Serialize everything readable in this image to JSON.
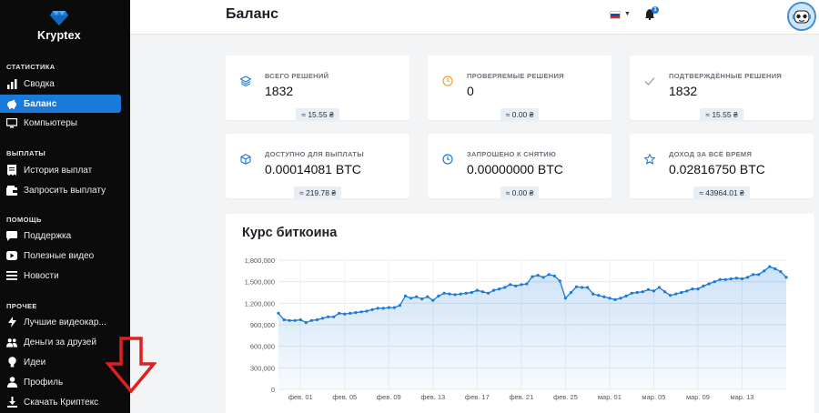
{
  "brand": {
    "name": "Kryptex",
    "accent": "#1a7ad9"
  },
  "sidebar": {
    "sections": [
      {
        "title": "СТАТИСТИКА",
        "items": [
          {
            "label": "Сводка",
            "icon": "chart-bar-icon"
          },
          {
            "label": "Баланс",
            "icon": "piggy-bank-icon",
            "active": true
          },
          {
            "label": "Компьютеры",
            "icon": "monitor-icon"
          }
        ]
      },
      {
        "title": "ВЫПЛАТЫ",
        "items": [
          {
            "label": "История выплат",
            "icon": "receipt-icon"
          },
          {
            "label": "Запросить выплату",
            "icon": "wallet-icon"
          }
        ]
      },
      {
        "title": "ПОМОЩЬ",
        "items": [
          {
            "label": "Поддержка",
            "icon": "chat-icon"
          },
          {
            "label": "Полезные видео",
            "icon": "youtube-icon"
          },
          {
            "label": "Новости",
            "icon": "list-icon"
          }
        ]
      },
      {
        "title": "ПРОЧЕЕ",
        "items": [
          {
            "label": "Лучшие видеокар...",
            "icon": "bolt-icon"
          },
          {
            "label": "Деньги за друзей",
            "icon": "users-icon"
          },
          {
            "label": "Идеи",
            "icon": "lightbulb-icon"
          },
          {
            "label": "Профиль",
            "icon": "user-icon"
          },
          {
            "label": "Скачать Криптекс",
            "icon": "download-icon"
          }
        ]
      }
    ]
  },
  "header": {
    "title": "Баланс",
    "notification_count": "1",
    "language": "ru"
  },
  "stats": [
    {
      "label": "ВСЕГО РЕШЕНИЙ",
      "value": "1832",
      "equiv": "≈ 15.55 ₴",
      "icon": "layers-icon",
      "icon_color": "#1a7ad9"
    },
    {
      "label": "ПРОВЕРЯЕМЫЕ РЕШЕНИЯ",
      "value": "0",
      "equiv": "≈ 0.00 ₴",
      "icon": "clock-icon",
      "icon_color": "#f0a13a"
    },
    {
      "label": "ПОДТВЕРЖДЁННЫЕ РЕШЕНИЯ",
      "value": "1832",
      "equiv": "≈ 15.55 ₴",
      "icon": "check-icon",
      "icon_color": "#9aa0aa"
    },
    {
      "label": "ДОСТУПНО ДЛЯ ВЫПЛАТЫ",
      "value": "0.00014081 BTC",
      "equiv": "≈ 219.78 ₴",
      "icon": "cube-icon",
      "icon_color": "#1a7ad9"
    },
    {
      "label": "ЗАПРОШЕНО К СНЯТИЮ",
      "value": "0.00000000 BTC",
      "equiv": "≈ 0.00 ₴",
      "icon": "clock-icon",
      "icon_color": "#1a7ad9"
    },
    {
      "label": "ДОХОД ЗА ВСЁ ВРЕМЯ",
      "value": "0.02816750 BTC",
      "equiv": "≈ 43964.01 ₴",
      "icon": "star-icon",
      "icon_color": "#1a7ad9"
    }
  ],
  "chart_data": {
    "type": "area",
    "title": "Курс биткоина",
    "xlabel": "",
    "ylabel": "",
    "ylim": [
      0,
      1800000
    ],
    "yticks": [
      0,
      300000,
      600000,
      900000,
      1200000,
      1500000,
      1800000
    ],
    "ytick_labels": [
      "0",
      "300,000",
      "600,000",
      "900,000",
      "1,200,000",
      "1,500,000",
      "1,800,000"
    ],
    "xtick_labels": [
      "фев. 01",
      "фев. 05",
      "фев. 09",
      "фев. 13",
      "фев. 17",
      "фев. 21",
      "фев. 25",
      "мар. 01",
      "мар. 05",
      "мар. 09",
      "мар. 13"
    ],
    "grid": true,
    "color": "#1a7ad9",
    "series": [
      {
        "values": [
          1060000,
          970000,
          960000,
          960000,
          970000,
          930000,
          960000,
          970000,
          990000,
          1010000,
          1010000,
          1060000,
          1050000,
          1060000,
          1070000,
          1080000,
          1090000,
          1110000,
          1130000,
          1130000,
          1140000,
          1140000,
          1170000,
          1300000,
          1270000,
          1290000,
          1260000,
          1290000,
          1240000,
          1300000,
          1340000,
          1330000,
          1320000,
          1330000,
          1340000,
          1350000,
          1380000,
          1360000,
          1340000,
          1380000,
          1400000,
          1420000,
          1460000,
          1440000,
          1460000,
          1470000,
          1570000,
          1590000,
          1560000,
          1600000,
          1580000,
          1510000,
          1270000,
          1350000,
          1430000,
          1420000,
          1420000,
          1330000,
          1310000,
          1290000,
          1270000,
          1250000,
          1270000,
          1300000,
          1340000,
          1350000,
          1360000,
          1390000,
          1370000,
          1420000,
          1360000,
          1310000,
          1330000,
          1350000,
          1370000,
          1400000,
          1400000,
          1440000,
          1470000,
          1500000,
          1530000,
          1530000,
          1540000,
          1550000,
          1540000,
          1560000,
          1600000,
          1600000,
          1650000,
          1710000,
          1680000,
          1640000,
          1560000
        ]
      }
    ]
  }
}
